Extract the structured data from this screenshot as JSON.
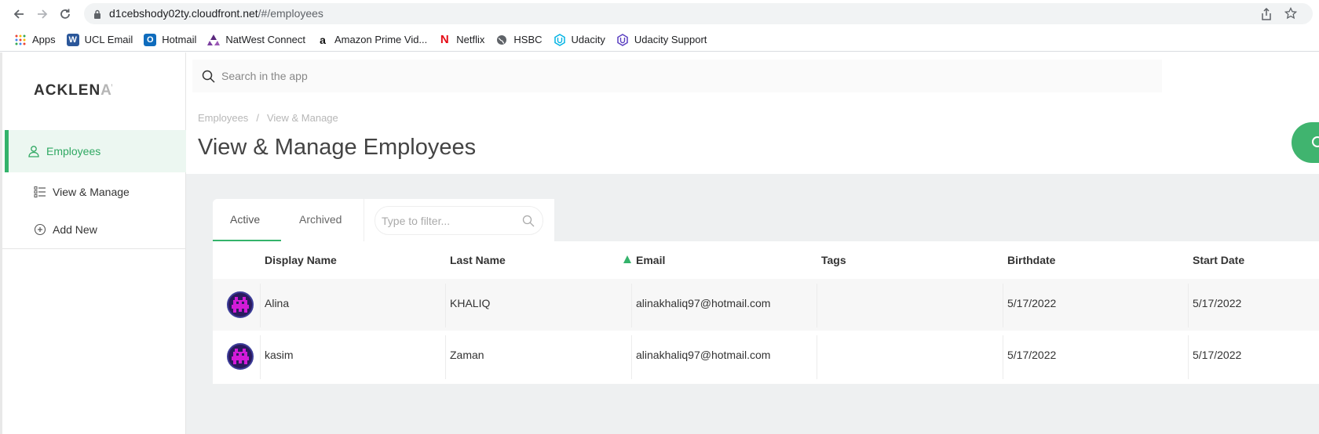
{
  "browser": {
    "url_host": "d1cebshody02ty.cloudfront.net",
    "url_path": "/#/employees"
  },
  "bookmarks": [
    {
      "label": "Apps",
      "icon": "apps-grid-icon"
    },
    {
      "label": "UCL Email",
      "icon": "word-icon"
    },
    {
      "label": "Hotmail",
      "icon": "outlook-icon"
    },
    {
      "label": "NatWest Connect",
      "icon": "natwest-icon"
    },
    {
      "label": "Amazon Prime Vid...",
      "icon": "amazon-icon"
    },
    {
      "label": "Netflix",
      "icon": "netflix-icon"
    },
    {
      "label": "HSBC",
      "icon": "globe-icon"
    },
    {
      "label": "Udacity",
      "icon": "udacity-icon"
    },
    {
      "label": "Udacity Support",
      "icon": "udacity-icon"
    }
  ],
  "sidebar": {
    "logo": "ACKLEN",
    "logo_fade": "AV",
    "active_item": "Employees",
    "items": [
      {
        "label": "View & Manage",
        "icon": "list-icon"
      },
      {
        "label": "Add New",
        "icon": "plus-circle-icon"
      }
    ]
  },
  "header": {
    "search_placeholder": "Search in the app",
    "breadcrumb": [
      "Employees",
      "View & Manage"
    ],
    "breadcrumb_sep": "/",
    "title": "View & Manage Employees"
  },
  "tabs": {
    "active": "Active",
    "archived": "Archived",
    "filter_placeholder": "Type to filter..."
  },
  "table": {
    "columns": [
      "Display Name",
      "Last Name",
      "Email",
      "Tags",
      "Birthdate",
      "Start Date"
    ],
    "rows": [
      {
        "display_name": "Alina",
        "last_name": "KHALIQ",
        "email": "alinakhaliq97@hotmail.com",
        "tags": "",
        "birthdate": "5/17/2022",
        "start_date": "5/17/2022"
      },
      {
        "display_name": "kasim",
        "last_name": "Zaman",
        "email": "alinakhaliq97@hotmail.com",
        "tags": "",
        "birthdate": "5/17/2022",
        "start_date": "5/17/2022"
      }
    ]
  },
  "colors": {
    "accent": "#34b36b",
    "avatar_bg": "#2a1a5e",
    "avatar_fg": "#d21bd8"
  }
}
